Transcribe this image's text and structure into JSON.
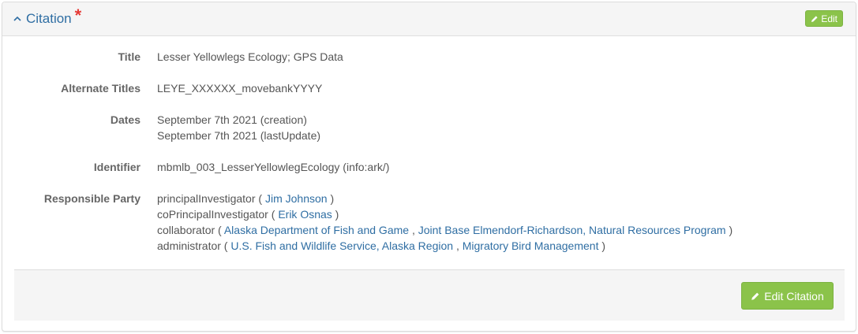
{
  "header": {
    "title": "Citation",
    "required_mark": "*",
    "edit_label": "Edit"
  },
  "fields": {
    "title": {
      "label": "Title",
      "value": "Lesser Yellowlegs Ecology; GPS Data"
    },
    "alternate_titles": {
      "label": "Alternate Titles",
      "value": "LEYE_XXXXXX_movebankYYYY"
    },
    "dates": {
      "label": "Dates",
      "values": [
        "September 7th 2021 (creation)",
        "September 7th 2021 (lastUpdate)"
      ]
    },
    "identifier": {
      "label": "Identifier",
      "value": "mbmlb_003_LesserYellowlegEcology (info:ark/)"
    },
    "responsible_party": {
      "label": "Responsible Party",
      "entries": [
        {
          "role": "principalInvestigator",
          "parties": [
            "Jim Johnson"
          ]
        },
        {
          "role": "coPrincipalInvestigator",
          "parties": [
            "Erik Osnas"
          ]
        },
        {
          "role": "collaborator",
          "parties": [
            "Alaska Department of Fish and Game",
            "Joint Base Elmendorf-Richardson, Natural Resources Program"
          ]
        },
        {
          "role": "administrator",
          "parties": [
            "U.S. Fish and Wildlife Service, Alaska Region",
            "Migratory Bird Management"
          ]
        }
      ]
    }
  },
  "footer": {
    "edit_citation_label": "Edit Citation"
  },
  "colors": {
    "accent_green": "#8bc34a",
    "link_blue": "#2f6ea3",
    "required_red": "#e53935"
  }
}
